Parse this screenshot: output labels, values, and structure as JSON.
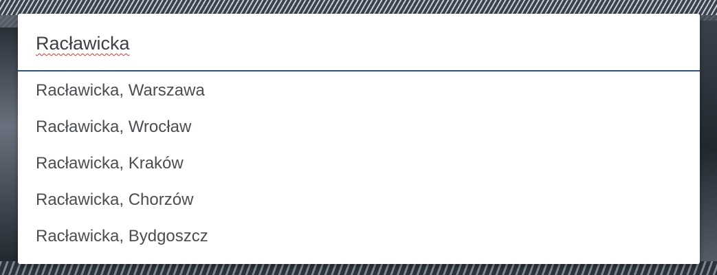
{
  "search": {
    "value": "Racławicka",
    "spellcheck_flagged": true
  },
  "suggestions": [
    {
      "label": "Racławicka, Warszawa"
    },
    {
      "label": "Racławicka, Wrocław"
    },
    {
      "label": "Racławicka, Kraków"
    },
    {
      "label": "Racławicka, Chorzów"
    },
    {
      "label": "Racławicka, Bydgoszcz"
    }
  ],
  "colors": {
    "input_underline": "#2f4f84",
    "text": "#4a4d52",
    "spellcheck": "#d8342f",
    "panel_background": "#ffffff"
  }
}
